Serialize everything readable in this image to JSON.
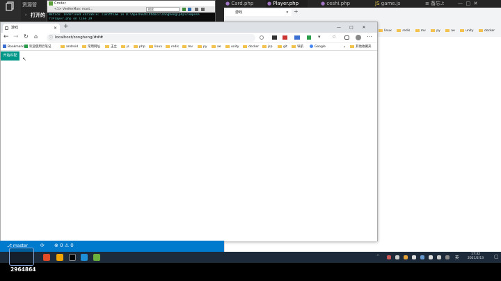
{
  "vscode": {
    "sidebar_title": "资源管",
    "open_editors_label": "打开的",
    "tabs": [
      {
        "label": "Card.php"
      },
      {
        "label": "Player.php",
        "active": true
      },
      {
        "label": "ceshi.php"
      },
      {
        "label": "game.js"
      },
      {
        "label": "备忘.t"
      }
    ],
    "status": {
      "branch": "master",
      "errors": "0",
      "warnings": "0"
    }
  },
  "cmd_window": {
    "title": "Cmder",
    "subtitle": "<1> VeeKerMan: mast...",
    "search_placeholder": "搜索",
    "notice_line1": "Notice: Undefined variable: limittime in D:\\Apache24\\htdocs\\zongheng\\php\\compose",
    "notice_line2": "r\\Player.php on line 29"
  },
  "back_window": {
    "tab_label": "游戏",
    "bookmarks": [
      "linux",
      "redis",
      "mv",
      "py",
      "ae",
      "unity",
      "docker"
    ]
  },
  "browser": {
    "tab_title": "游戏",
    "url": "localhost/zongheng/###",
    "bookmarks": [
      {
        "label": "Bookmarks",
        "type": "apps"
      },
      {
        "label": "欢迎使用云笔记",
        "type": "site"
      },
      {
        "label": "android",
        "type": "folder"
      },
      {
        "label": "常用网址",
        "type": "folder"
      },
      {
        "label": "王立",
        "type": "folder"
      },
      {
        "label": "js",
        "type": "folder"
      },
      {
        "label": "php",
        "type": "folder"
      },
      {
        "label": "linux",
        "type": "folder"
      },
      {
        "label": "redis",
        "type": "folder"
      },
      {
        "label": "mv",
        "type": "folder"
      },
      {
        "label": "py",
        "type": "folder"
      },
      {
        "label": "ae",
        "type": "folder"
      },
      {
        "label": "unity",
        "type": "folder"
      },
      {
        "label": "docker",
        "type": "folder"
      },
      {
        "label": "jsp",
        "type": "folder"
      },
      {
        "label": "git",
        "type": "folder"
      },
      {
        "label": "导航",
        "type": "folder"
      },
      {
        "label": "Google",
        "type": "site"
      }
    ],
    "other_bookmarks": "其他收藏夹",
    "start_button": "开始匹配"
  },
  "taskbar": {
    "time": "17:32",
    "date": "2021/2/13",
    "tray_lang": "英"
  },
  "watermark": {
    "channel_id": "2964864"
  },
  "colors": {
    "vscode_status": "#007acc",
    "start_button": "#009688",
    "taskbar": "#1c2a3a"
  }
}
